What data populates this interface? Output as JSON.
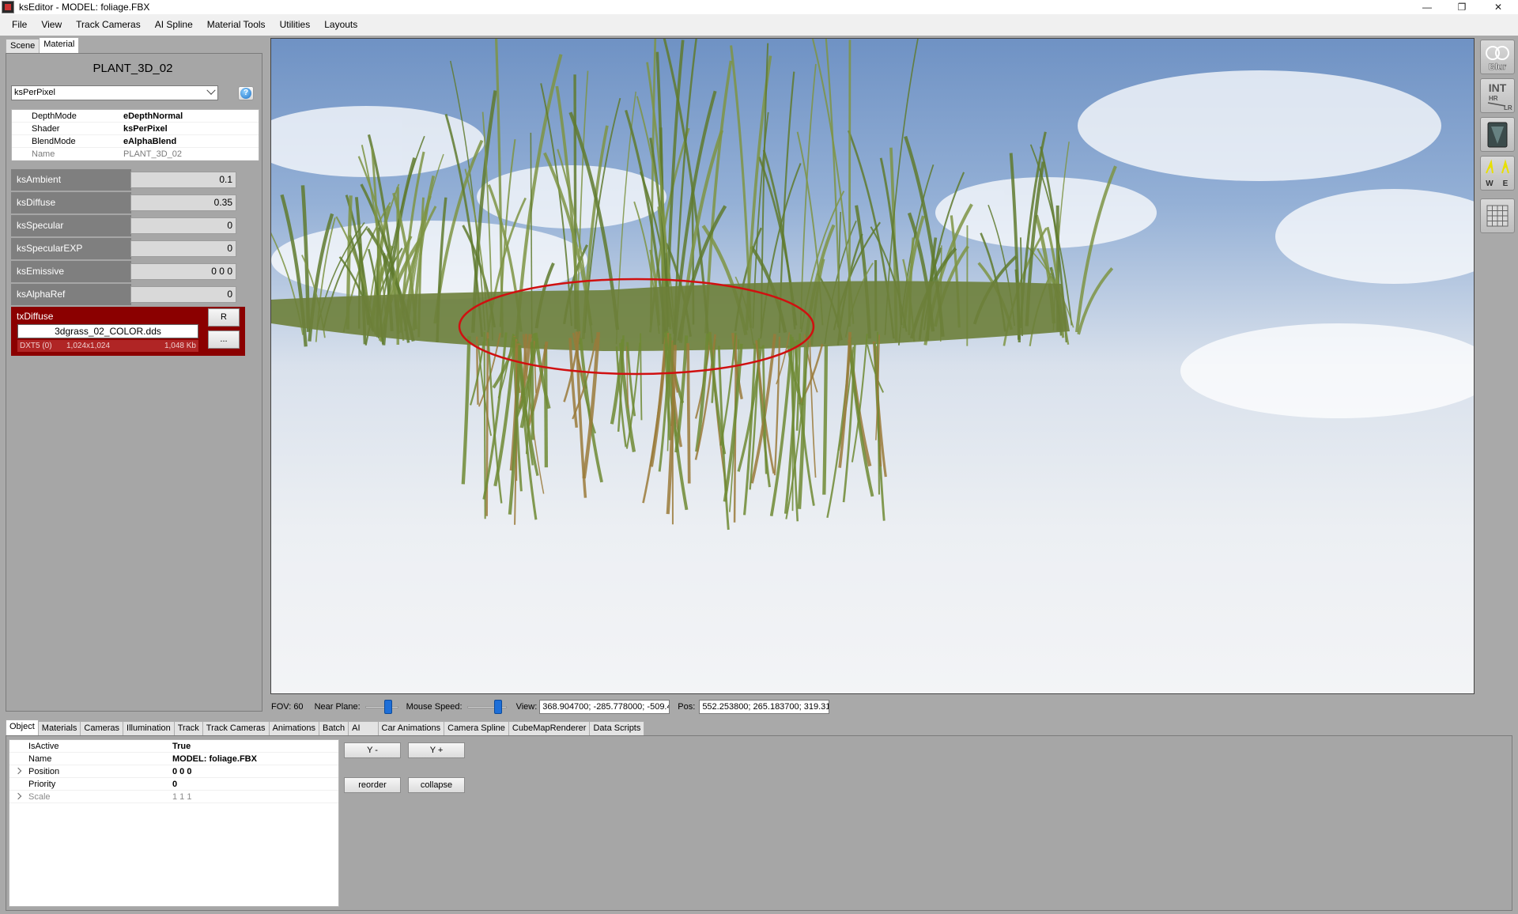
{
  "window": {
    "title": "ksEditor - MODEL: foliage.FBX",
    "controls": [
      "—",
      "❐",
      "✕"
    ]
  },
  "menu": [
    "File",
    "View",
    "Track Cameras",
    "AI Spline",
    "Material Tools",
    "Utilities",
    "Layouts"
  ],
  "left_tabs": [
    {
      "label": "Scene",
      "active": false
    },
    {
      "label": "Material",
      "active": true
    }
  ],
  "material": {
    "name": "PLANT_3D_02",
    "shader_select": "ksPerPixel",
    "help_icon": "info-icon",
    "properties": [
      {
        "key": "DepthMode",
        "value": "eDepthNormal",
        "dim": false
      },
      {
        "key": "Shader",
        "value": "ksPerPixel",
        "dim": false
      },
      {
        "key": "BlendMode",
        "value": "eAlphaBlend",
        "dim": false
      },
      {
        "key": "Name",
        "value": "PLANT_3D_02",
        "dim": true
      }
    ],
    "shader_params": [
      {
        "label": "ksAmbient",
        "value": "0.1"
      },
      {
        "label": "ksDiffuse",
        "value": "0.35"
      },
      {
        "label": "ksSpecular",
        "value": "0"
      },
      {
        "label": "ksSpecularEXP",
        "value": "0"
      },
      {
        "label": "ksEmissive",
        "value": "0 0 0"
      },
      {
        "label": "ksAlphaRef",
        "value": "0"
      }
    ],
    "texture": {
      "slot": "txDiffuse",
      "file": "3dgrass_02_COLOR.dds",
      "format": "DXT5 (0)",
      "dimensions": "1,024x1,024",
      "size": "1,048 Kb",
      "reload_label": "R",
      "browse_label": "..."
    }
  },
  "right_toolbar": [
    "blur-icon",
    "int-hr-lr-icon",
    "texture-panel-icon",
    "wind-we-icon",
    "grid-icon"
  ],
  "right_toolbar_text": {
    "blur": "Blur",
    "int": "INT",
    "hr": "HR",
    "lr": "LR",
    "w": "W",
    "e": "E"
  },
  "status": {
    "fov": "FOV: 60",
    "near_plane_label": "Near Plane:",
    "mouse_speed_label": "Mouse Speed:",
    "view_label": "View:",
    "view_value": "368.904700; -285.778000; -509.4",
    "pos_label": "Pos:",
    "pos_value": "552.253800; 265.183700; 319.31"
  },
  "bottom_tabs": [
    {
      "label": "Object",
      "active": true
    },
    {
      "label": "Materials",
      "active": false
    },
    {
      "label": "Cameras",
      "active": false
    },
    {
      "label": "Illumination",
      "active": false
    },
    {
      "label": "Track",
      "active": false
    },
    {
      "label": "Track Cameras",
      "active": false
    },
    {
      "label": "Animations",
      "active": false
    },
    {
      "label": "Batch",
      "active": false
    },
    {
      "label": "AI",
      "active": false
    },
    {
      "label": "Car Animations",
      "active": false
    },
    {
      "label": "Camera Spline",
      "active": false
    },
    {
      "label": "CubeMapRenderer",
      "active": false
    },
    {
      "label": "Data Scripts",
      "active": false
    }
  ],
  "object_props": [
    {
      "key": "IsActive",
      "value": "True",
      "expandable": false,
      "dim": false
    },
    {
      "key": "Name",
      "value": "MODEL: foliage.FBX",
      "expandable": false,
      "dim": false
    },
    {
      "key": "Position",
      "value": "0 0 0",
      "expandable": true,
      "dim": false
    },
    {
      "key": "Priority",
      "value": "0",
      "expandable": false,
      "dim": false
    },
    {
      "key": "Scale",
      "value": "1 1 1",
      "expandable": true,
      "dim": true
    }
  ],
  "object_buttons": {
    "y_minus": "Y -",
    "y_plus": "Y +",
    "reorder": "reorder",
    "collapse": "collapse"
  },
  "colors": {
    "texture_panel": "#8b0000",
    "highlight_ellipse": "#d01010",
    "slider_thumb": "#1e6fd8"
  }
}
